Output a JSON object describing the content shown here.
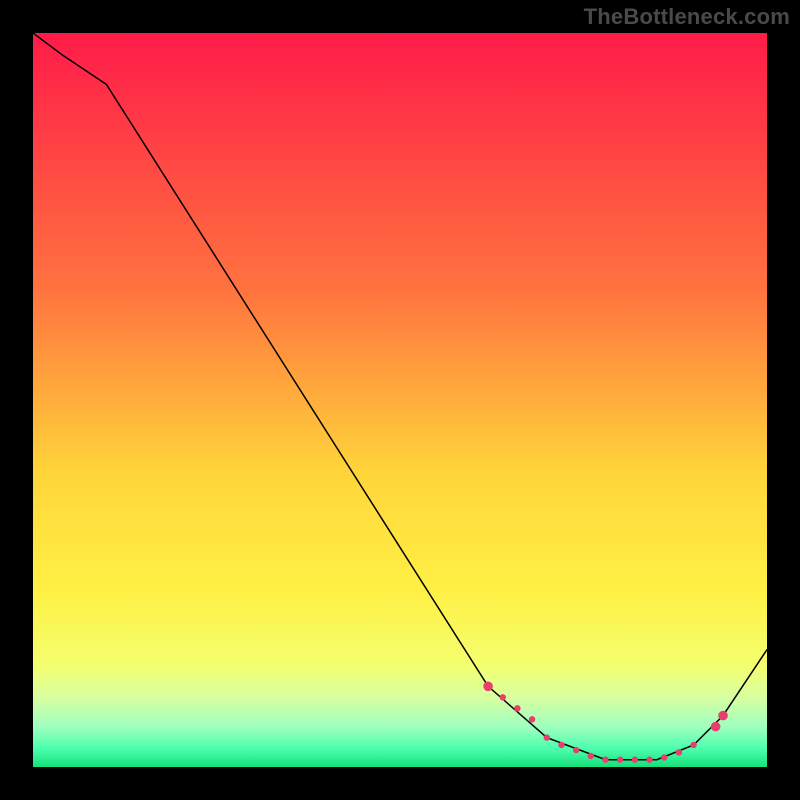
{
  "watermark": "TheBottleneck.com",
  "colors": {
    "frame": "#000000",
    "curve": "#000000",
    "marker": "#e83f6f",
    "gradient_stops": [
      {
        "offset": 0,
        "color": "#ff1b49"
      },
      {
        "offset": 0.35,
        "color": "#ff733f"
      },
      {
        "offset": 0.6,
        "color": "#ffd53a"
      },
      {
        "offset": 0.76,
        "color": "#fff045"
      },
      {
        "offset": 0.86,
        "color": "#f4ff6e"
      },
      {
        "offset": 0.905,
        "color": "#d8ffa0"
      },
      {
        "offset": 0.945,
        "color": "#9fffc0"
      },
      {
        "offset": 0.975,
        "color": "#4bffad"
      },
      {
        "offset": 1.0,
        "color": "#14e07a"
      }
    ]
  },
  "chart_data": {
    "type": "line",
    "title": "",
    "xlabel": "",
    "ylabel": "",
    "xlim": [
      0,
      100
    ],
    "ylim": [
      0,
      100
    ],
    "series": [
      {
        "name": "curve",
        "x": [
          0,
          4,
          10,
          62,
          70,
          78,
          85,
          90,
          94,
          100
        ],
        "y": [
          100,
          97,
          93,
          11,
          4,
          1,
          1,
          3,
          7,
          16
        ]
      }
    ],
    "markers": {
      "name": "highlight",
      "x": [
        62,
        64,
        66,
        68,
        70,
        72,
        74,
        76,
        78,
        80,
        82,
        84,
        86,
        88,
        90,
        93,
        94
      ],
      "y": [
        11,
        9.5,
        8,
        6.5,
        4,
        3,
        2.3,
        1.5,
        1,
        1,
        1,
        1,
        1.3,
        2,
        3,
        5.5,
        7
      ],
      "sizes": [
        3,
        2,
        2,
        2,
        2,
        2,
        2,
        2,
        2,
        2,
        2,
        2,
        2,
        2,
        2,
        3,
        3
      ]
    }
  }
}
